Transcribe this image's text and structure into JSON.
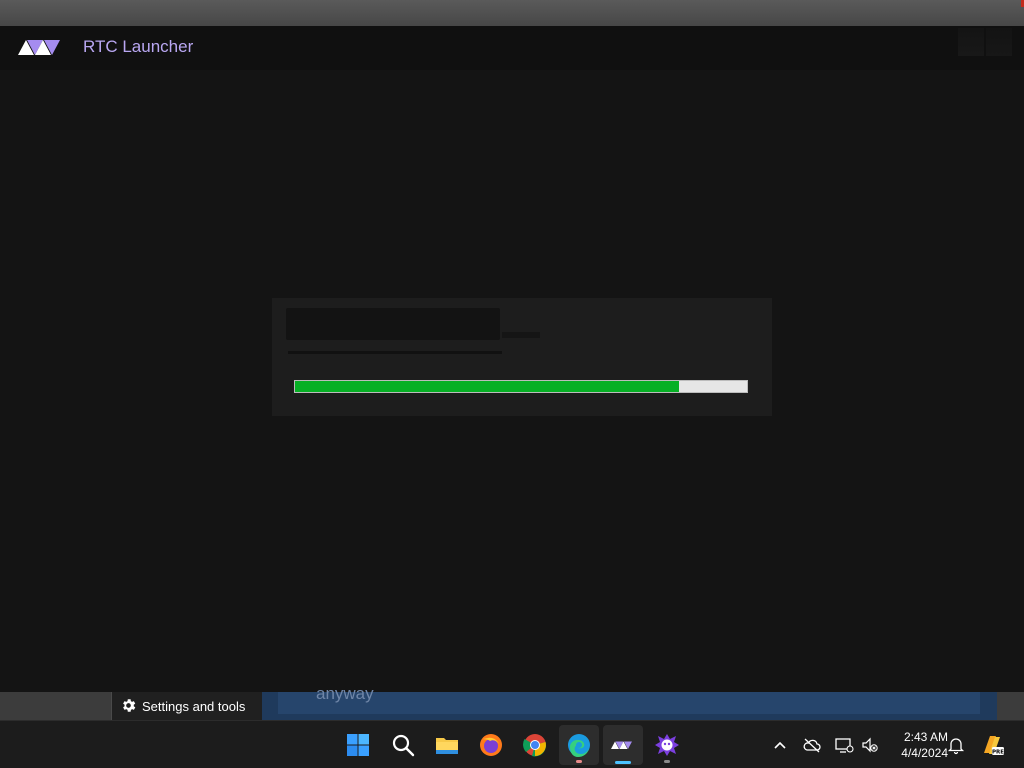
{
  "app": {
    "title": "RTC Launcher",
    "accent": "#b9a7f2",
    "logo_icon": "rtc-logo-icon"
  },
  "dialog": {
    "progress_fraction": 0.85,
    "progress_color": "#06b025"
  },
  "background_window": {
    "settings_label": "Settings and tools",
    "partial_text": "anyway"
  },
  "taskbar": {
    "apps": [
      {
        "name": "start",
        "icon": "windows-icon"
      },
      {
        "name": "search",
        "icon": "search-icon"
      },
      {
        "name": "file-explorer",
        "icon": "folder-icon"
      },
      {
        "name": "firefox",
        "icon": "firefox-icon"
      },
      {
        "name": "chrome",
        "icon": "chrome-icon"
      },
      {
        "name": "edge",
        "icon": "edge-icon"
      },
      {
        "name": "rtc-launcher",
        "icon": "rtc-logo-icon"
      },
      {
        "name": "game",
        "icon": "game-icon"
      }
    ],
    "time": "2:43 AM",
    "date": "4/4/2024"
  }
}
